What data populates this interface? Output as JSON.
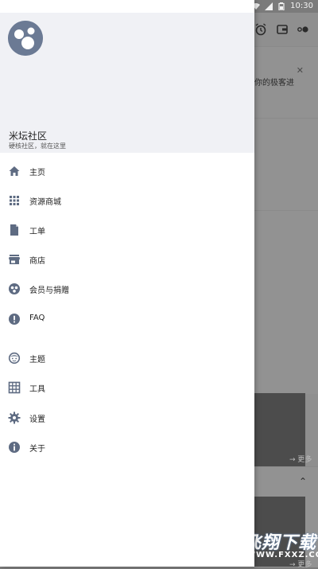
{
  "status_bar": {
    "time": "10:30"
  },
  "drawer": {
    "header": {
      "title": "米坛社区",
      "subtitle": "硬核社区，就在这里"
    },
    "menu": [
      {
        "label": "主页",
        "icon": "home-icon"
      },
      {
        "label": "资源商城",
        "icon": "grid-apps-icon"
      },
      {
        "label": "工单",
        "icon": "document-icon"
      },
      {
        "label": "商店",
        "icon": "store-icon"
      },
      {
        "label": "会员与捐赠",
        "icon": "membership-icon"
      },
      {
        "label": "FAQ",
        "icon": "alert-circle-icon"
      },
      {
        "label": "主题",
        "icon": "face-icon"
      },
      {
        "label": "工具",
        "icon": "table-grid-icon"
      },
      {
        "label": "设置",
        "icon": "gear-icon"
      },
      {
        "label": "关于",
        "icon": "info-icon"
      }
    ]
  },
  "background": {
    "card_text": "你的极客进",
    "more_label_1": "→ 更多",
    "more_label_2": "→ 更多"
  },
  "watermark": {
    "title": "飞翔下载",
    "url": "WWW.FXXZ.COM"
  },
  "colors": {
    "accent": "#6b7a94",
    "header_bg": "#f0f1f5",
    "scrim": "#7b7b7b"
  }
}
